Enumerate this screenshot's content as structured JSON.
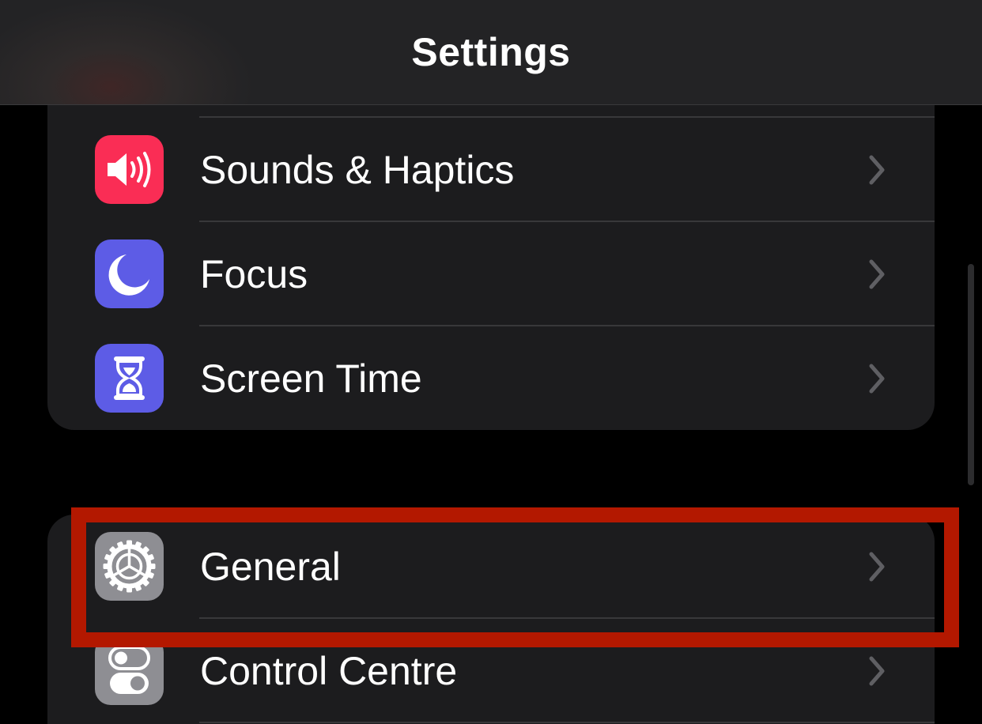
{
  "navbar": {
    "title": "Settings"
  },
  "groups": {
    "top": {
      "items": [
        {
          "label": "Sounds & Haptics",
          "icon": "speaker-icon",
          "icon_color": "#fa2d55"
        },
        {
          "label": "Focus",
          "icon": "moon-icon",
          "icon_color": "#5d5ce6"
        },
        {
          "label": "Screen Time",
          "icon": "hourglass-icon",
          "icon_color": "#5d5ce6"
        }
      ]
    },
    "bottom": {
      "items": [
        {
          "label": "General",
          "icon": "gear-icon",
          "icon_color": "#8e8e93",
          "highlighted": true
        },
        {
          "label": "Control Centre",
          "icon": "toggles-icon",
          "icon_color": "#8e8e93"
        }
      ]
    }
  },
  "colors": {
    "background": "#000000",
    "group_background": "#1c1c1e",
    "separator": "#38383a",
    "chevron": "#5f5f63",
    "highlight_border": "#b31800"
  }
}
